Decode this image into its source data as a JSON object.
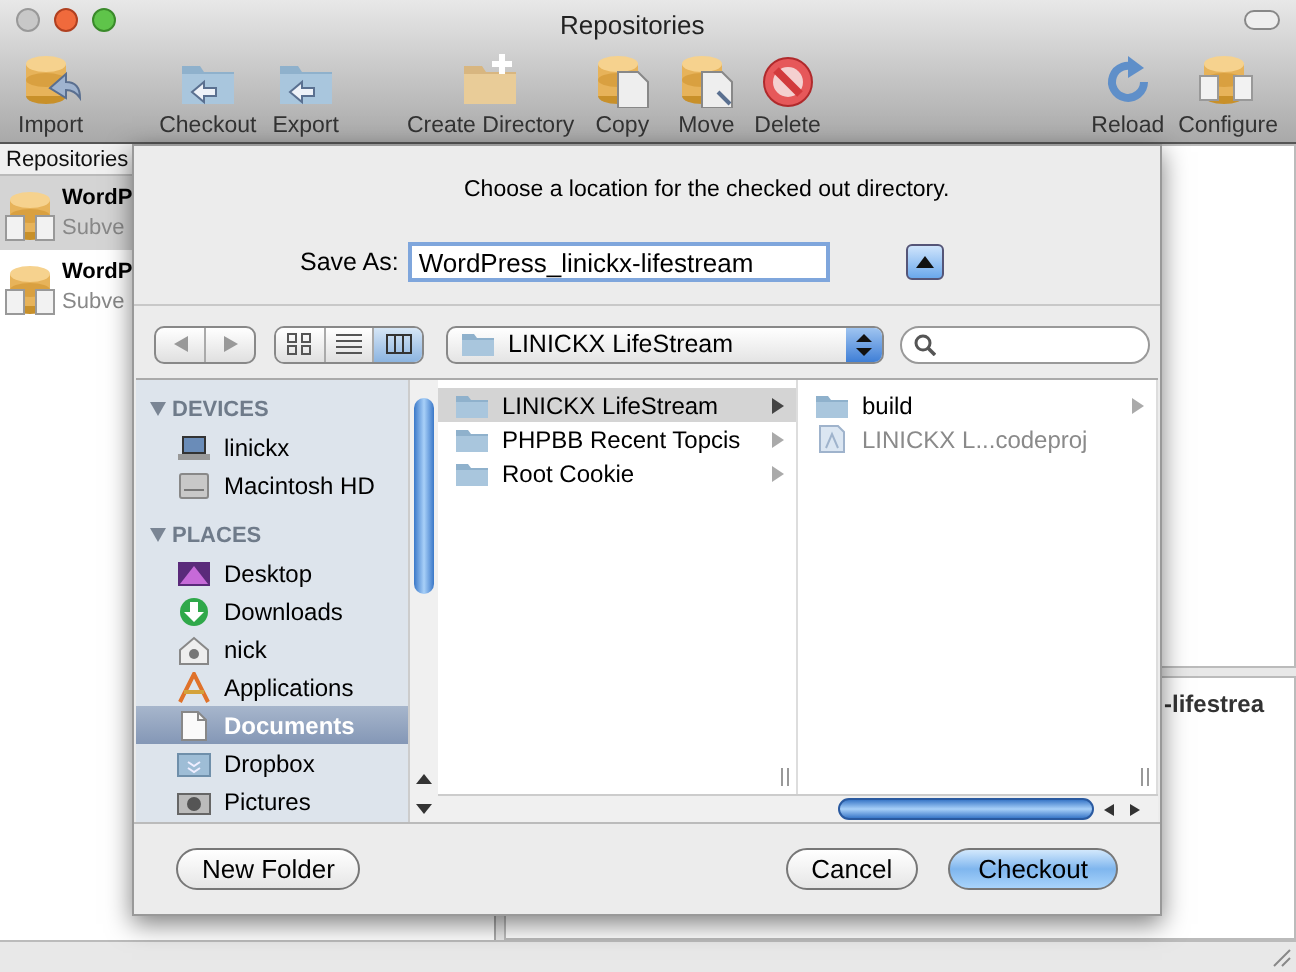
{
  "window": {
    "title": "Repositories"
  },
  "toolbar": [
    {
      "label": "Import",
      "kind": "import"
    },
    {
      "label": "Checkout",
      "kind": "checkout"
    },
    {
      "label": "Export",
      "kind": "export"
    },
    {
      "label": "Create Directory",
      "kind": "create"
    },
    {
      "label": "Copy",
      "kind": "copy"
    },
    {
      "label": "Move",
      "kind": "move"
    },
    {
      "label": "Delete",
      "kind": "delete"
    },
    {
      "label": "Reload",
      "kind": "reload"
    },
    {
      "label": "Configure",
      "kind": "configure"
    }
  ],
  "repositories": {
    "header": "Repositories",
    "items": [
      {
        "name": "WordP",
        "type": "Subve",
        "selected": true
      },
      {
        "name": "WordP",
        "type": "Subve",
        "selected": false
      }
    ]
  },
  "detail_pane": {
    "text": "-lifestrea"
  },
  "sheet": {
    "message": "Choose a location for the checked out directory.",
    "save_as": {
      "label": "Save As:",
      "value": "WordPress_linickx-lifestream",
      "expanded": true
    },
    "view_modes": [
      {
        "kind": "icon",
        "selected": false
      },
      {
        "kind": "list",
        "selected": false
      },
      {
        "kind": "column",
        "selected": true
      }
    ],
    "location": "LINICKX LifeStream",
    "sidebar": [
      {
        "header": "DEVICES",
        "expanded": true,
        "items": [
          {
            "label": "linickx",
            "kind": "laptop",
            "selected": false
          },
          {
            "label": "Macintosh HD",
            "kind": "disk",
            "selected": false
          }
        ]
      },
      {
        "header": "PLACES",
        "expanded": true,
        "items": [
          {
            "label": "Desktop",
            "kind": "desktop",
            "selected": false
          },
          {
            "label": "Downloads",
            "kind": "downloads",
            "selected": false
          },
          {
            "label": "nick",
            "kind": "home",
            "selected": false
          },
          {
            "label": "Applications",
            "kind": "applications",
            "selected": false
          },
          {
            "label": "Documents",
            "kind": "documents",
            "selected": true
          },
          {
            "label": "Dropbox",
            "kind": "dropbox",
            "selected": false
          },
          {
            "label": "Pictures",
            "kind": "pictures",
            "selected": false
          }
        ]
      }
    ],
    "columns": [
      [
        {
          "label": "LINICKX LifeStream",
          "kind": "folder",
          "selected": true,
          "disabled": false,
          "has_children": true
        },
        {
          "label": "PHPBB Recent Topcis",
          "kind": "folder",
          "selected": false,
          "disabled": false,
          "has_children": true
        },
        {
          "label": "Root Cookie",
          "kind": "folder",
          "selected": false,
          "disabled": false,
          "has_children": true
        }
      ],
      [
        {
          "label": "build",
          "kind": "folder",
          "selected": false,
          "disabled": false,
          "has_children": true
        },
        {
          "label": "LINICKX L...codeproj",
          "kind": "project",
          "selected": false,
          "disabled": true,
          "has_children": false
        }
      ]
    ],
    "buttons": [
      {
        "label": "New Folder",
        "default": false
      },
      {
        "label": "Cancel",
        "default": false
      },
      {
        "label": "Checkout",
        "default": true
      }
    ]
  }
}
